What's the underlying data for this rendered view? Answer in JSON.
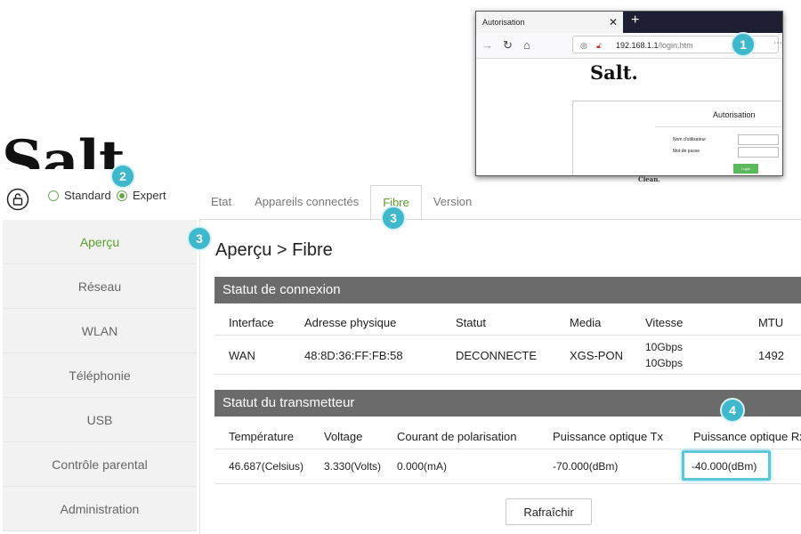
{
  "brand": {
    "logo": "Salt.",
    "accent": "#5aa02c",
    "highlight": "#3fb8cc"
  },
  "mode": {
    "options": [
      "Standard",
      "Expert"
    ],
    "selected": "Expert"
  },
  "tabs": [
    "Etat",
    "Appareils connectés",
    "Fibre",
    "Version"
  ],
  "active_tab": "Fibre",
  "sidebar": {
    "items": [
      {
        "label": "Aperçu"
      },
      {
        "label": "Réseau"
      },
      {
        "label": "WLAN"
      },
      {
        "label": "Téléphonie"
      },
      {
        "label": "USB"
      },
      {
        "label": "Contrôle parental"
      },
      {
        "label": "Administration"
      }
    ],
    "active": "Aperçu"
  },
  "main": {
    "title": "Aperçu > Fibre",
    "connection": {
      "heading": "Statut de connexion",
      "columns": [
        "Interface",
        "Adresse physique",
        "Statut",
        "Media",
        "Vitesse",
        "MTU"
      ],
      "row": {
        "interface": "WAN",
        "mac": "48:8D:36:FF:FB:58",
        "status": "DECONNECTE",
        "media": "XGS-PON",
        "speed_up": "10Gbps",
        "speed_down": "10Gbps",
        "mtu": "1492"
      }
    },
    "transmitter": {
      "heading": "Statut du transmetteur",
      "columns": [
        "Température",
        "Voltage",
        "Courant de polarisation",
        "Puissance optique Tx",
        "Puissance optique Rx"
      ],
      "row": {
        "temperature": "46.687(Celsius)",
        "voltage": "3.330(Volts)",
        "bias": "0.000(mA)",
        "tx": "-70.000(dBm)",
        "rx": "-40.000(dBm)"
      }
    },
    "refresh_label": "Rafraîchir"
  },
  "inset": {
    "tab_title": "Autorisation",
    "url_host": "192.168.1.1",
    "url_path": "/login.htm",
    "logo": "Salt.",
    "panel_title": "Autorisation",
    "username_label": "Nom d'utilisateur",
    "password_label": "Mot de passe",
    "login_button": "Login",
    "footer": "Clean."
  },
  "badges": [
    "1",
    "2",
    "3",
    "3",
    "4"
  ]
}
